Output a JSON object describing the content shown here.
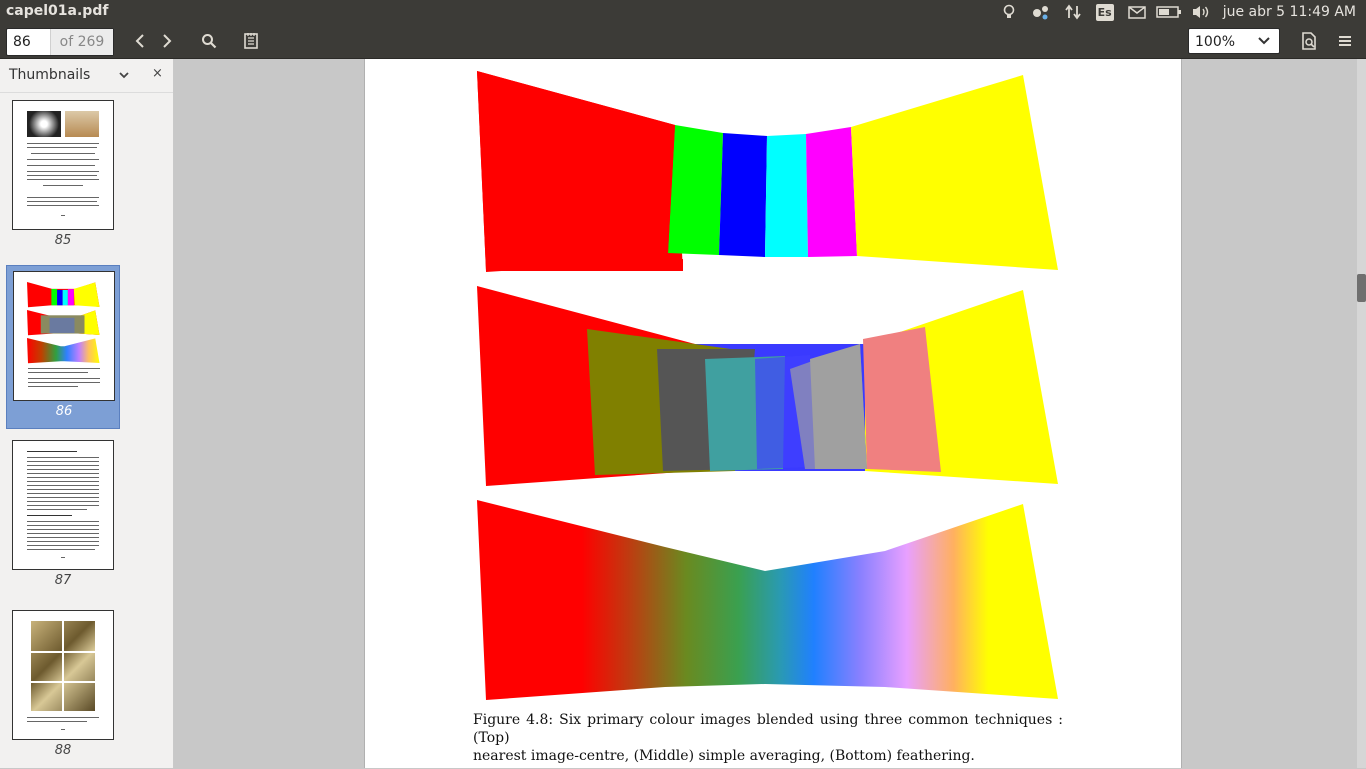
{
  "window": {
    "title": "capel01a.pdf"
  },
  "tray": {
    "clock": "jue abr  5 11:49 AM",
    "keyboard_layout": "Es",
    "icons": [
      "lightbulb-icon",
      "network-icon",
      "transfer-icon",
      "keyboard-icon",
      "mail-icon",
      "battery-icon",
      "volume-icon"
    ]
  },
  "toolbar": {
    "page_current": "86",
    "page_total": "of 269",
    "zoom": "100%",
    "icons": [
      "chevron-left-icon",
      "chevron-right-icon",
      "search-icon",
      "annotations-icon",
      "document-properties-icon",
      "menu-icon"
    ]
  },
  "sidebar": {
    "title": "Thumbnails",
    "close": "×",
    "thumbnails": [
      {
        "page": "85",
        "selected": false
      },
      {
        "page": "86",
        "selected": true
      },
      {
        "page": "87",
        "selected": false
      },
      {
        "page": "88",
        "selected": false
      }
    ]
  },
  "document": {
    "figure": {
      "rows": [
        "Top",
        "Middle",
        "Bottom"
      ],
      "strip_colors": [
        "#ff0000",
        "#00ff00",
        "#0000ff",
        "#00ffff",
        "#ff00ff",
        "#ffff00"
      ],
      "averaged_colors": [
        "#808000",
        "#555555",
        "#40a0a0",
        "#5555ff",
        "#a0a0a0",
        "#f08080"
      ]
    },
    "caption": {
      "line1": "Figure 4.8:  Six primary colour images blended using three common techniques :  (Top)",
      "line2": "nearest image-centre, (Middle) simple averaging, (Bottom) feathering."
    }
  }
}
